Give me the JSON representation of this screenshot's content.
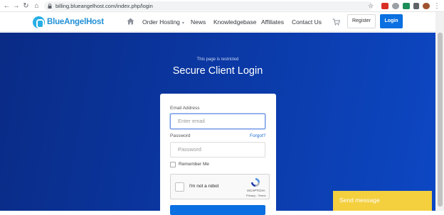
{
  "browser": {
    "url": "billing.blueangelhost.com/index.php/login"
  },
  "header": {
    "logo_text": "BlueAngelHost",
    "menu": {
      "order_hosting": "Order Hosting",
      "news": "News",
      "knowledgebase": "Knowledgebase",
      "affiliates": "Affiliates",
      "contact_us": "Contact Us"
    },
    "register_label": "Register",
    "login_label": "Login"
  },
  "hero": {
    "restricted_text": "This page is restricted",
    "title": "Secure Client Login"
  },
  "form": {
    "email_label": "Email Address",
    "email_placeholder": "Enter email",
    "password_label": "Password",
    "password_placeholder": "Password",
    "forgot_label": "Forgot?",
    "remember_label": "Remember Me"
  },
  "captcha": {
    "text": "I'm not a robot",
    "brand": "reCAPTCHA",
    "links": "Privacy - Terms"
  },
  "chat": {
    "label": "Send message"
  },
  "colors": {
    "brand_blue": "#0a6fe0",
    "hero_start": "#0a2b86",
    "hero_end": "#0d47c3",
    "chat_yellow": "#f4d03f"
  }
}
